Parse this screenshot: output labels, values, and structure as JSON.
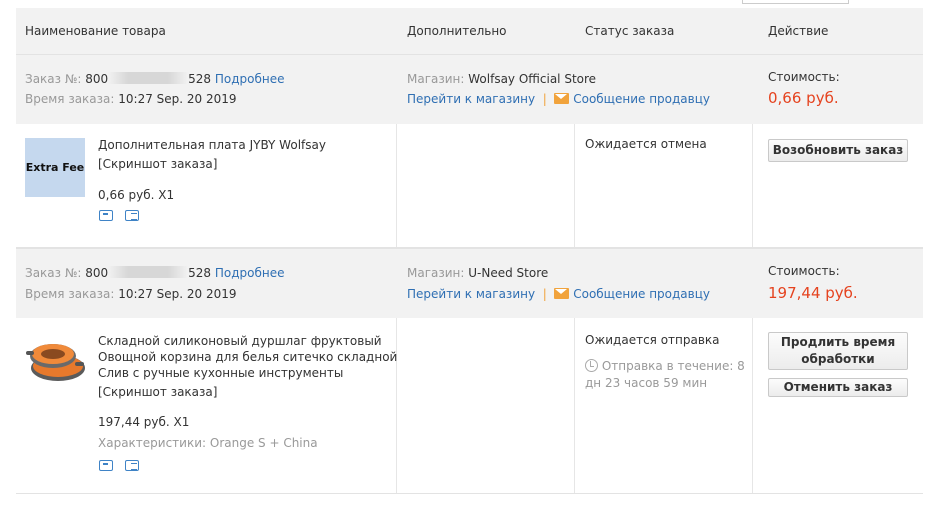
{
  "header": {
    "col_name": "Наименование товара",
    "col_extra": "Дополнительно",
    "col_status": "Статус заказа",
    "col_action": "Действие"
  },
  "orders": [
    {
      "order_label": "Заказ №:",
      "order_no_start": "800",
      "order_no_end": "528",
      "details_link": "Подробнее",
      "time_label": "Время заказа:",
      "time_value": "10:27 Sep. 20 2019",
      "store_label": "Магазин:",
      "store_name": "Wolfsay Official Store",
      "store_link": "Перейти к магазину",
      "message_link": "Сообщение продавцу",
      "cost_label": "Стоимость:",
      "cost_value": "0,66 руб.",
      "item_thumb_text": "Extra Fee",
      "item_title": "Дополнительная плата JYBY Wolfsay",
      "snapshot_link": "[Скриншот заказа]",
      "item_price": "0,66 руб. X1",
      "status": "Ожидается отмена",
      "action_btn": "Возобновить заказ"
    },
    {
      "order_label": "Заказ №:",
      "order_no_start": "800",
      "order_no_end": "528",
      "details_link": "Подробнее",
      "time_label": "Время заказа:",
      "time_value": "10:27 Sep. 20 2019",
      "store_label": "Магазин:",
      "store_name": "U-Need Store",
      "store_link": "Перейти к магазину",
      "message_link": "Сообщение продавцу",
      "cost_label": "Стоимость:",
      "cost_value": "197,44 руб.",
      "item_title_l1": "Складной силиконовый дуршлаг фруктовый",
      "item_title_l2": "Овощной корзина для белья ситечко складной",
      "item_title_l3": "Слив с ручные кухонные инструменты",
      "snapshot_link": "[Скриншот заказа]",
      "item_price": "197,44 руб. X1",
      "characteristics": "Характеристики: Orange S + China",
      "status": "Ожидается отправка",
      "ship_l1": "Отправка в течение: 8",
      "ship_l2": "дн 23 часов 59 мин",
      "action_btn_1": "Продлить время обработки",
      "action_btn_2": "Отменить заказ"
    }
  ],
  "colors": {
    "accent_link": "#2f6fb3",
    "price_red": "#e5431f",
    "header_bg": "#f2f2f2"
  }
}
